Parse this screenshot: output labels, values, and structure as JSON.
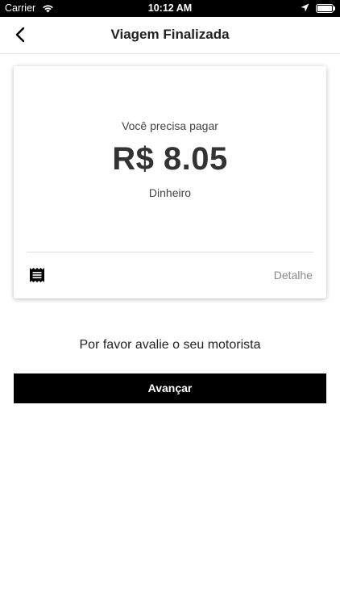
{
  "status_bar": {
    "carrier": "Carrier",
    "time": "10:12 AM",
    "icons": [
      "wifi-icon",
      "location-arrow-icon",
      "battery-icon"
    ]
  },
  "nav": {
    "title": "Viagem Finalizada",
    "back_icon": "chevron-left-icon"
  },
  "card": {
    "label": "Você precisa pagar",
    "amount": "R$ 8.05",
    "method": "Dinheiro",
    "receipt_icon": "receipt-icon",
    "detail_label": "Detalhe"
  },
  "rating": {
    "prompt": "Por favor avalie o seu motorista"
  },
  "actions": {
    "next_label": "Avançar"
  },
  "colors": {
    "primary_button": "#000000",
    "background": "#ffffff",
    "muted_text": "#8a8a8a"
  }
}
